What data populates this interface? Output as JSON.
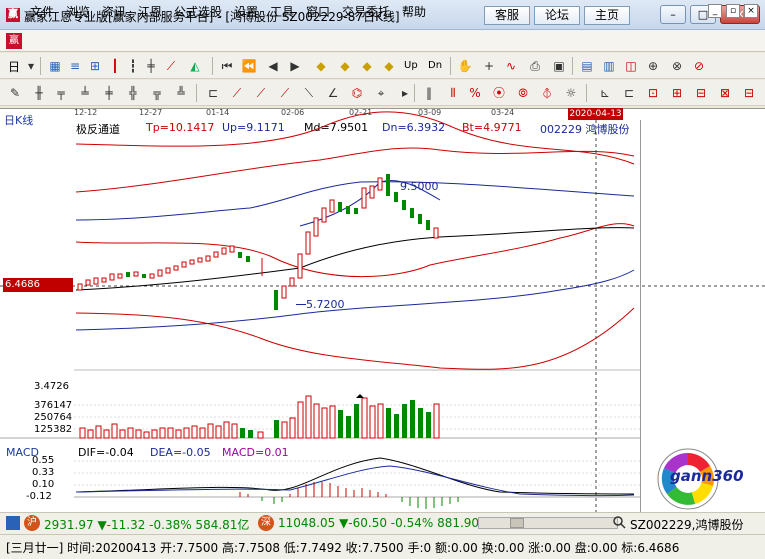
{
  "window": {
    "title": "赢家江恩专业版[赢家内部服务平台] - [鸿博股份   SZ002229-87日K线]",
    "top_buttons": [
      "客服",
      "论坛",
      "主页"
    ],
    "minimize": "–",
    "maximize": "□",
    "close": "✕"
  },
  "menu": {
    "logo": "赢",
    "items": [
      "文件",
      "浏览",
      "资讯",
      "江恩",
      "公式选股",
      "设置",
      "工具",
      "窗口",
      "交易委托",
      "帮助"
    ],
    "mdi_buttons": [
      "_",
      "▫",
      "×"
    ]
  },
  "toolbar1": {
    "period_label": "日",
    "icons": [
      "dropdown-icon",
      "grid-icon",
      "rank-icon",
      "table-icon",
      "candlestick-icon",
      "bar-icon",
      "tick-icon",
      "gann-fan-icon",
      "zoom-icon",
      "first-icon",
      "prev-page-icon",
      "prev-icon",
      "next-icon",
      "diamond-up-icon",
      "diamond-down-icon",
      "diamond-left-icon",
      "diamond-right-icon",
      "up-arrow-icon",
      "dn-arrow-icon",
      "hand-icon",
      "cross-icon",
      "wave-icon",
      "print-icon",
      "save-icon",
      "calendar-icon",
      "select-icon",
      "window-icon",
      "tool1-icon",
      "tool2-icon"
    ],
    "labels": [
      "Up",
      "Dn"
    ]
  },
  "toolbar2": {
    "icons": [
      "pencil-icon",
      "line-icon",
      "parallel-icon",
      "triangle-icon",
      "fib-icon",
      "circle-icon",
      "arc-icon",
      "gann-square-icon",
      "time-cycle-icon",
      "box-icon",
      "speed-icon",
      "channel-icon",
      "fan-icon",
      "angle-icon",
      "hex-icon",
      "percent-icon",
      "lock-icon",
      "erase-icon",
      "text-icon",
      "copy-icon",
      "layout-icon",
      "home-icon",
      "arrow-icon"
    ]
  },
  "chart": {
    "period": "日K线",
    "dates": [
      "12-12",
      "12-27",
      "01-14",
      "02-06",
      "02-21",
      "03-09",
      "03-24"
    ],
    "indicator_name": "极反通道",
    "tp": "Tp=10.1417",
    "up": "Up=9.1171",
    "md": "Md=7.9501",
    "dn": "Dn=6.3932",
    "bt": "Bt=4.9771",
    "stock": "002229  鸿博股份",
    "date_flag": "2020-04-13",
    "cursor_price": "6.4686",
    "high_label": "9.5000",
    "low_label": "5.7200",
    "volume_axis": [
      "3.4726",
      "376147",
      "250764",
      "125382"
    ],
    "macd": {
      "name": "MACD",
      "dif": "DIF=-0.04",
      "dea": "DEA=-0.05",
      "macd": "MACD=0.01",
      "axis": [
        "0.55",
        "0.33",
        "0.10",
        "-0.12"
      ]
    },
    "logo_text": "gann360",
    "colors": {
      "up": "#cc0000",
      "down": "#008800",
      "band": "#cc0000",
      "mid": "#000000",
      "inner": "#1a2a9a"
    }
  },
  "index_bar": {
    "sh_icon": "沪",
    "sh_text": "2931.97 ▼-11.32 -0.38% 584.81亿",
    "sz_icon": "深",
    "sz_text": "11048.05 ▼-60.50 -0.54% 881.90",
    "scroll_stock": "SZ002229,鸿博股份"
  },
  "status": {
    "text": "[三月廿一] 时间:20200413 开:7.7500 高:7.7508 低:7.7492 收:7.7500 手:0 额:0.00 换:0.00 涨:0.00 盘:0.00 标:6.4686"
  }
}
